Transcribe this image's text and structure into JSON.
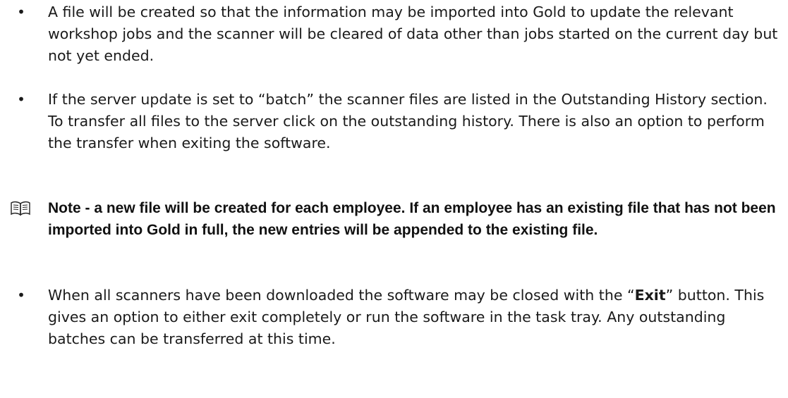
{
  "paragraphs": {
    "p1": {
      "bullet": "•",
      "text": "A file will be created so that the information may be imported into Gold to update the relevant workshop jobs and the scanner will be cleared of data other than jobs started on the current day but not yet ended."
    },
    "p2": {
      "bullet": "•",
      "text": "If the server update is set to “batch” the scanner files are listed in the Outstanding History section.  To transfer all files to the server click on the outstanding history.  There is also an option to perform the transfer when exiting the software."
    },
    "note": {
      "icon": "book-icon",
      "text": "Note - a new file will be created for each employee.  If an employee has an existing file that has not been imported into Gold in full, the new entries will be appended to the existing file."
    },
    "p3": {
      "bullet": "•",
      "text_before": "When all scanners have been downloaded the software may be closed with the “",
      "bold": "Exit",
      "text_after": "” button.  This gives an option to either exit completely or run the software in the task tray.  Any outstanding batches can be transferred at this time."
    }
  }
}
